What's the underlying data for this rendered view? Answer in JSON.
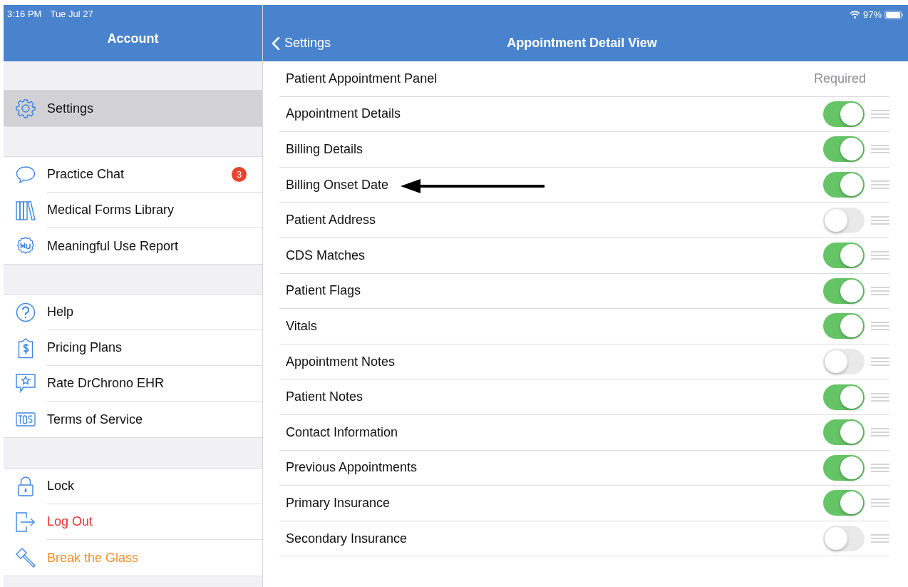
{
  "status_bar": {
    "time": "3:16 PM",
    "date": "Tue Jul 27",
    "battery": "97%"
  },
  "sidebar": {
    "title": "Account",
    "groups": [
      [
        {
          "label": "Settings",
          "selected": true,
          "kind": "normal"
        }
      ],
      [
        {
          "label": "Practice Chat",
          "selected": false,
          "kind": "normal",
          "badge": "3"
        },
        {
          "label": "Medical Forms Library",
          "selected": false,
          "kind": "normal"
        },
        {
          "label": "Meaningful Use Report",
          "selected": false,
          "kind": "normal"
        }
      ],
      [
        {
          "label": "Help",
          "selected": false,
          "kind": "normal"
        },
        {
          "label": "Pricing Plans",
          "selected": false,
          "kind": "normal"
        },
        {
          "label": "Rate DrChrono EHR",
          "selected": false,
          "kind": "normal"
        },
        {
          "label": "Terms of Service",
          "selected": false,
          "kind": "normal"
        }
      ],
      [
        {
          "label": "Lock",
          "selected": false,
          "kind": "normal"
        },
        {
          "label": "Log Out",
          "selected": false,
          "kind": "destructive"
        },
        {
          "label": "Break the Glass",
          "selected": false,
          "kind": "warning"
        }
      ]
    ]
  },
  "detail": {
    "back": "Settings",
    "title": "Appointment Detail View",
    "rows": [
      {
        "label": "Patient Appointment Panel",
        "kind": "required",
        "status": "Required"
      },
      {
        "label": "Appointment Details",
        "kind": "toggle",
        "on": true
      },
      {
        "label": "Billing Details",
        "kind": "toggle",
        "on": true
      },
      {
        "label": "Billing Onset Date",
        "kind": "toggle",
        "on": true
      },
      {
        "label": "Patient Address",
        "kind": "toggle",
        "on": false
      },
      {
        "label": "CDS Matches",
        "kind": "toggle",
        "on": true
      },
      {
        "label": "Patient Flags",
        "kind": "toggle",
        "on": true
      },
      {
        "label": "Vitals",
        "kind": "toggle",
        "on": true
      },
      {
        "label": "Appointment Notes",
        "kind": "toggle",
        "on": false
      },
      {
        "label": "Patient Notes",
        "kind": "toggle",
        "on": true
      },
      {
        "label": "Contact Information",
        "kind": "toggle",
        "on": true
      },
      {
        "label": "Previous Appointments",
        "kind": "toggle",
        "on": true
      },
      {
        "label": "Primary Insurance",
        "kind": "toggle",
        "on": true
      },
      {
        "label": "Secondary Insurance",
        "kind": "toggle",
        "on": false
      }
    ]
  }
}
